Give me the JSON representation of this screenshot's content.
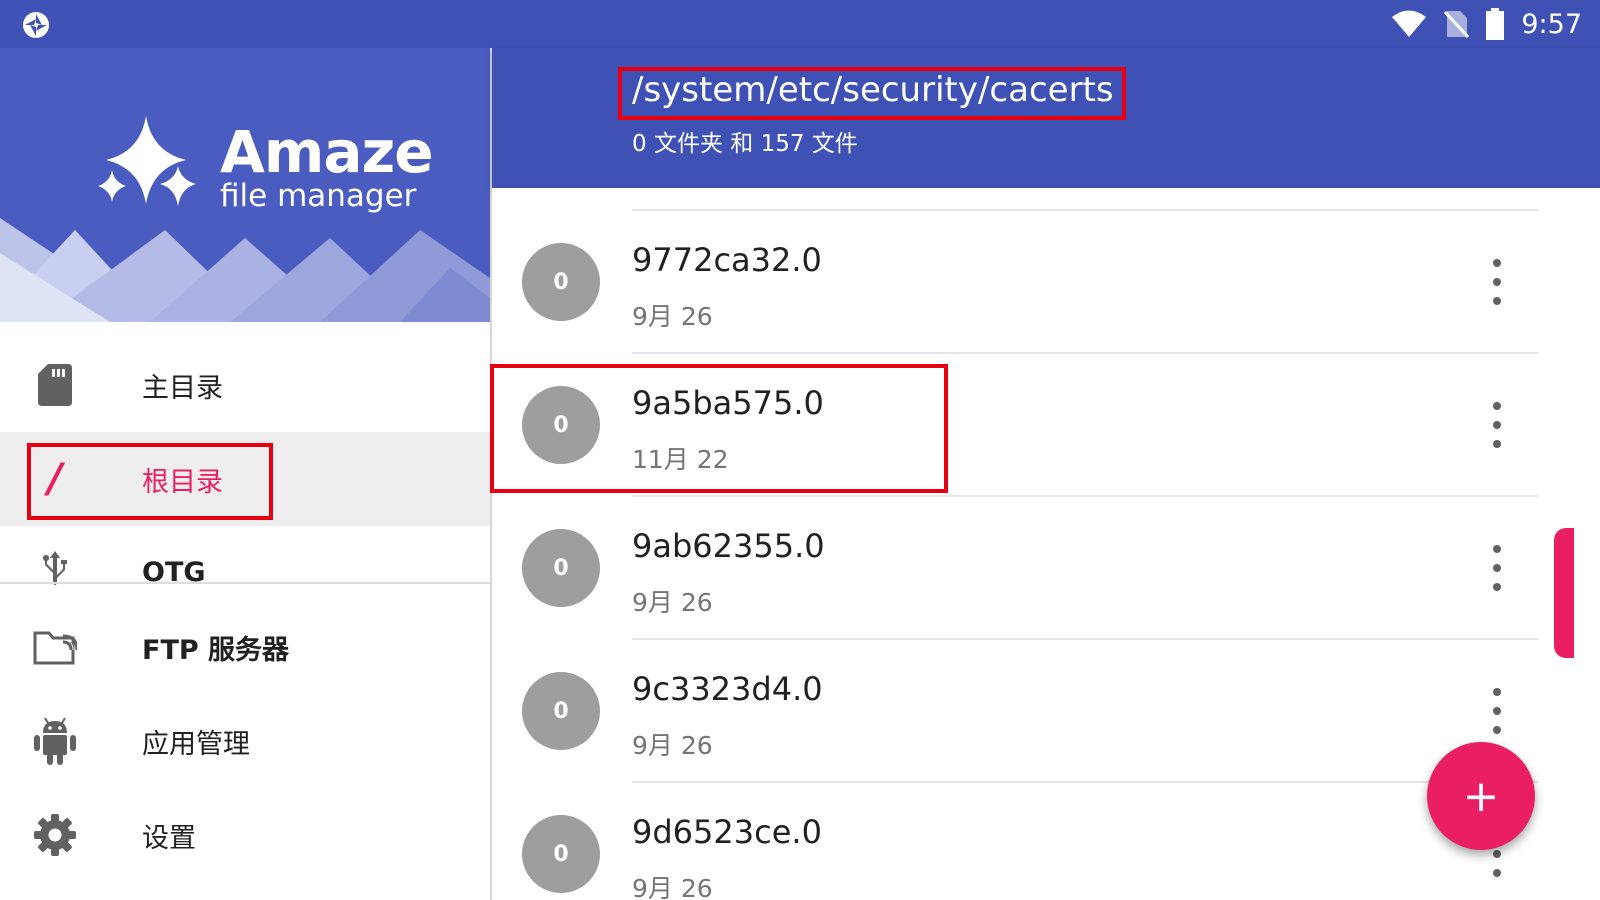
{
  "status_bar": {
    "time": "9:57",
    "icons": [
      "app-logo-icon",
      "wifi-icon",
      "no-sim-icon",
      "battery-icon"
    ]
  },
  "drawer": {
    "brand": {
      "title": "Amaze",
      "subtitle": "file manager"
    },
    "items": [
      {
        "label": "主目录",
        "icon": "sd-card-icon",
        "active": false
      },
      {
        "label": "根目录",
        "icon": "root-slash-icon",
        "active": true
      },
      {
        "label": "OTG",
        "icon": "usb-icon",
        "active": false
      },
      {
        "label": "FTP 服务器",
        "icon": "ftp-folder-icon",
        "active": false
      },
      {
        "label": "应用管理",
        "icon": "android-icon",
        "active": false
      },
      {
        "label": "设置",
        "icon": "gear-icon",
        "active": false
      }
    ],
    "root_glyph": "/"
  },
  "appbar": {
    "path": "/system/etc/security/cacerts",
    "summary": "0 文件夹 和 157 文件"
  },
  "files": [
    {
      "avatar": "0",
      "name": "9772ca32.0",
      "date": "9月 26"
    },
    {
      "avatar": "0",
      "name": "9a5ba575.0",
      "date": "11月 22"
    },
    {
      "avatar": "0",
      "name": "9ab62355.0",
      "date": "9月 26"
    },
    {
      "avatar": "0",
      "name": "9c3323d4.0",
      "date": "9月 26"
    },
    {
      "avatar": "0",
      "name": "9d6523ce.0",
      "date": "9月 26"
    }
  ],
  "fab": {
    "label": "+"
  },
  "colors": {
    "primary": "#3f51b5",
    "accent": "#e91e63",
    "highlight": "#e60012"
  }
}
